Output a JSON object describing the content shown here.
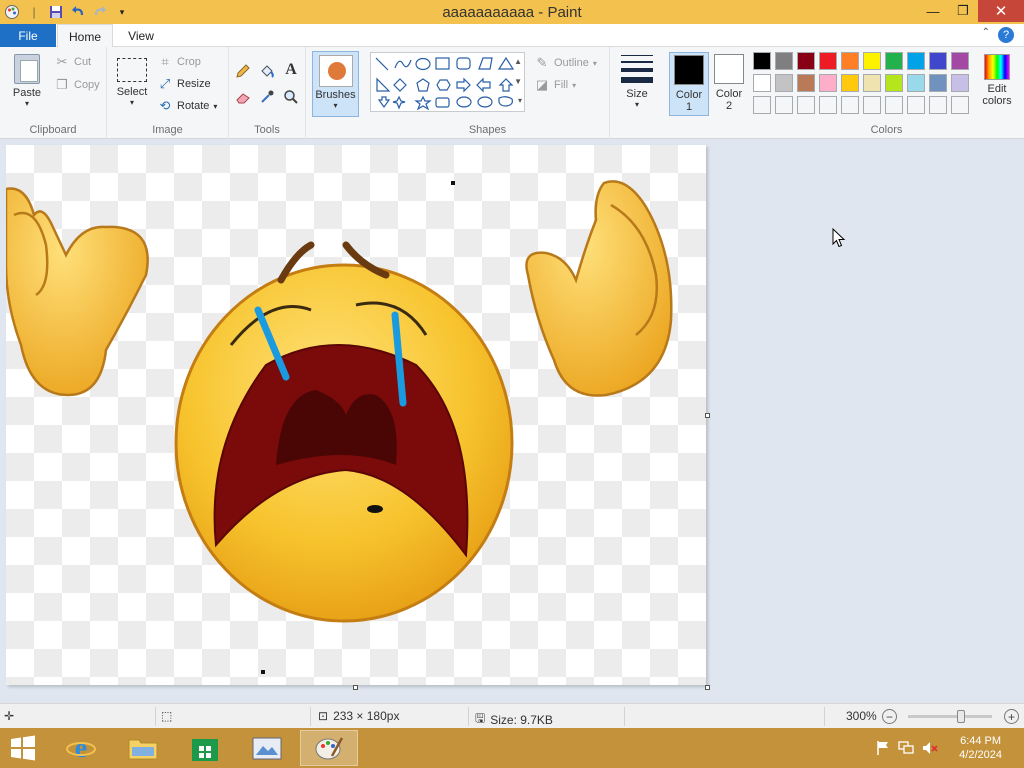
{
  "window": {
    "title": "aaaaaaaaaaa - Paint",
    "minimize": "—",
    "restore": "❐",
    "close": "✕"
  },
  "tabs": [
    {
      "label": "File"
    },
    {
      "label": "Home"
    },
    {
      "label": "View"
    }
  ],
  "help_icon": "?",
  "ribbon": {
    "clipboard": {
      "name": "Clipboard",
      "paste": "Paste",
      "cut": "Cut",
      "copy": "Copy"
    },
    "image": {
      "name": "Image",
      "select": "Select",
      "crop": "Crop",
      "resize": "Resize",
      "rotate": "Rotate"
    },
    "tools": {
      "name": "Tools"
    },
    "brushes": {
      "label": "Brushes"
    },
    "shapes": {
      "name": "Shapes",
      "outline": "Outline",
      "fill": "Fill"
    },
    "size": {
      "label": "Size"
    },
    "color1": {
      "label_line1": "Color",
      "label_line2": "1",
      "value": "#000000"
    },
    "color2": {
      "label_line1": "Color",
      "label_line2": "2",
      "value": "#ffffff"
    },
    "colors": {
      "name": "Colors",
      "edit_line1": "Edit",
      "edit_line2": "colors",
      "palette_row1": [
        "#000000",
        "#7f7f7f",
        "#880015",
        "#ed1c24",
        "#ff7f27",
        "#fff200",
        "#22b14c",
        "#00a2e8",
        "#3f48cc",
        "#a349a4"
      ],
      "palette_row2": [
        "#ffffff",
        "#c3c3c3",
        "#b97a57",
        "#ffaec9",
        "#ffc90e",
        "#efe4b0",
        "#b5e61d",
        "#99d9ea",
        "#7092be",
        "#c8bfe7"
      ]
    }
  },
  "status": {
    "image_size": "233 × 180px",
    "file_size": "Size: 9.7KB",
    "zoom": "300%"
  },
  "taskbar": {
    "time": "6:44 PM",
    "date": "4/2/2024"
  }
}
